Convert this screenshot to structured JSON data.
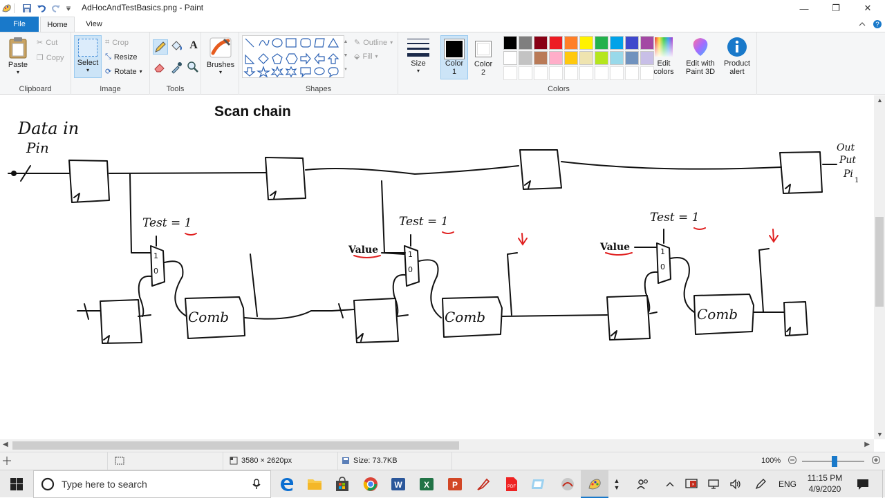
{
  "window": {
    "title": "AdHocAndTestBasics.png - Paint",
    "minimize": "—",
    "maximize": "❐",
    "close": "✕"
  },
  "tabs": {
    "file": "File",
    "home": "Home",
    "view": "View"
  },
  "ribbon": {
    "clipboard": {
      "paste": "Paste",
      "cut": "Cut",
      "copy": "Copy",
      "label": "Clipboard"
    },
    "image": {
      "select": "Select",
      "crop": "Crop",
      "resize": "Resize",
      "rotate": "Rotate",
      "label": "Image"
    },
    "tools": {
      "label": "Tools"
    },
    "brushes": "Brushes",
    "shapes": {
      "outline": "Outline",
      "fill": "Fill",
      "label": "Shapes"
    },
    "size": "Size",
    "color1": {
      "line1": "Color",
      "line2": "1"
    },
    "color2": {
      "line1": "Color",
      "line2": "2"
    },
    "colors": {
      "label": "Colors"
    },
    "edit_colors": {
      "line1": "Edit",
      "line2": "colors"
    },
    "paint3d": {
      "line1": "Edit with",
      "line2": "Paint 3D"
    },
    "product_alert": {
      "line1": "Product",
      "line2": "alert"
    }
  },
  "palette_row1": [
    "#000000",
    "#7f7f7f",
    "#880015",
    "#ed1c24",
    "#ff7f27",
    "#fff200",
    "#22b14c",
    "#00a2e8",
    "#3f48cc",
    "#a349a4"
  ],
  "palette_row2": [
    "#ffffff",
    "#c3c3c3",
    "#b97a57",
    "#ffaec9",
    "#ffc90e",
    "#efe4b0",
    "#b5e61d",
    "#99d9ea",
    "#7092be",
    "#c8bfe7"
  ],
  "color1_value": "#000000",
  "color2_value": "#ffffff",
  "canvas": {
    "heading": "Scan chain",
    "data_in_label_1": "Data in",
    "data_in_label_2": "Pin",
    "out_label_1": "Out",
    "out_label_2": "Put",
    "out_label_3": "Pi",
    "out_label_sub": "1",
    "test_label": "Test = 1",
    "value_label": "Value",
    "mux_top": "1",
    "mux_bottom": "0",
    "comb_label": "Comb"
  },
  "status": {
    "dimensions": "3580 × 2620px",
    "size": "Size: 73.7KB",
    "zoom": "100%"
  },
  "taskbar": {
    "search_placeholder": "Type here to search",
    "lang": "ENG",
    "time": "11:15 PM",
    "date": "4/9/2020"
  }
}
